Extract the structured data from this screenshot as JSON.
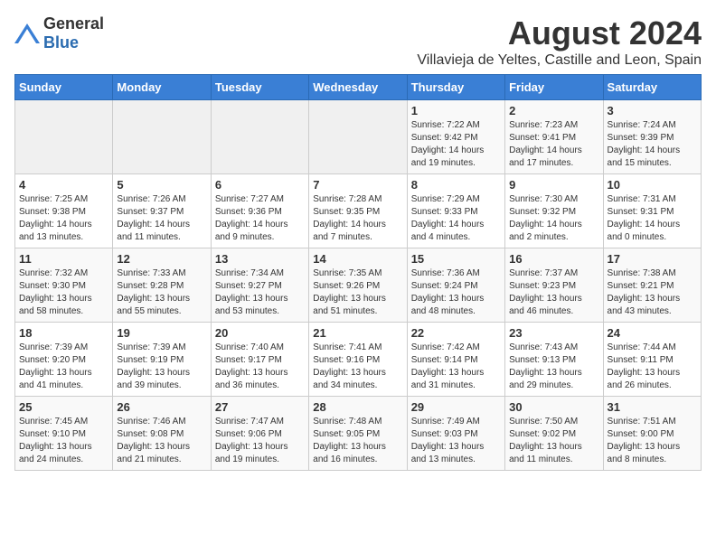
{
  "logo": {
    "text_general": "General",
    "text_blue": "Blue"
  },
  "title": "August 2024",
  "subtitle": "Villavieja de Yeltes, Castille and Leon, Spain",
  "days_of_week": [
    "Sunday",
    "Monday",
    "Tuesday",
    "Wednesday",
    "Thursday",
    "Friday",
    "Saturday"
  ],
  "weeks": [
    [
      {
        "day": "",
        "info": ""
      },
      {
        "day": "",
        "info": ""
      },
      {
        "day": "",
        "info": ""
      },
      {
        "day": "",
        "info": ""
      },
      {
        "day": "1",
        "info": "Sunrise: 7:22 AM\nSunset: 9:42 PM\nDaylight: 14 hours and 19 minutes."
      },
      {
        "day": "2",
        "info": "Sunrise: 7:23 AM\nSunset: 9:41 PM\nDaylight: 14 hours and 17 minutes."
      },
      {
        "day": "3",
        "info": "Sunrise: 7:24 AM\nSunset: 9:39 PM\nDaylight: 14 hours and 15 minutes."
      }
    ],
    [
      {
        "day": "4",
        "info": "Sunrise: 7:25 AM\nSunset: 9:38 PM\nDaylight: 14 hours and 13 minutes."
      },
      {
        "day": "5",
        "info": "Sunrise: 7:26 AM\nSunset: 9:37 PM\nDaylight: 14 hours and 11 minutes."
      },
      {
        "day": "6",
        "info": "Sunrise: 7:27 AM\nSunset: 9:36 PM\nDaylight: 14 hours and 9 minutes."
      },
      {
        "day": "7",
        "info": "Sunrise: 7:28 AM\nSunset: 9:35 PM\nDaylight: 14 hours and 7 minutes."
      },
      {
        "day": "8",
        "info": "Sunrise: 7:29 AM\nSunset: 9:33 PM\nDaylight: 14 hours and 4 minutes."
      },
      {
        "day": "9",
        "info": "Sunrise: 7:30 AM\nSunset: 9:32 PM\nDaylight: 14 hours and 2 minutes."
      },
      {
        "day": "10",
        "info": "Sunrise: 7:31 AM\nSunset: 9:31 PM\nDaylight: 14 hours and 0 minutes."
      }
    ],
    [
      {
        "day": "11",
        "info": "Sunrise: 7:32 AM\nSunset: 9:30 PM\nDaylight: 13 hours and 58 minutes."
      },
      {
        "day": "12",
        "info": "Sunrise: 7:33 AM\nSunset: 9:28 PM\nDaylight: 13 hours and 55 minutes."
      },
      {
        "day": "13",
        "info": "Sunrise: 7:34 AM\nSunset: 9:27 PM\nDaylight: 13 hours and 53 minutes."
      },
      {
        "day": "14",
        "info": "Sunrise: 7:35 AM\nSunset: 9:26 PM\nDaylight: 13 hours and 51 minutes."
      },
      {
        "day": "15",
        "info": "Sunrise: 7:36 AM\nSunset: 9:24 PM\nDaylight: 13 hours and 48 minutes."
      },
      {
        "day": "16",
        "info": "Sunrise: 7:37 AM\nSunset: 9:23 PM\nDaylight: 13 hours and 46 minutes."
      },
      {
        "day": "17",
        "info": "Sunrise: 7:38 AM\nSunset: 9:21 PM\nDaylight: 13 hours and 43 minutes."
      }
    ],
    [
      {
        "day": "18",
        "info": "Sunrise: 7:39 AM\nSunset: 9:20 PM\nDaylight: 13 hours and 41 minutes."
      },
      {
        "day": "19",
        "info": "Sunrise: 7:39 AM\nSunset: 9:19 PM\nDaylight: 13 hours and 39 minutes."
      },
      {
        "day": "20",
        "info": "Sunrise: 7:40 AM\nSunset: 9:17 PM\nDaylight: 13 hours and 36 minutes."
      },
      {
        "day": "21",
        "info": "Sunrise: 7:41 AM\nSunset: 9:16 PM\nDaylight: 13 hours and 34 minutes."
      },
      {
        "day": "22",
        "info": "Sunrise: 7:42 AM\nSunset: 9:14 PM\nDaylight: 13 hours and 31 minutes."
      },
      {
        "day": "23",
        "info": "Sunrise: 7:43 AM\nSunset: 9:13 PM\nDaylight: 13 hours and 29 minutes."
      },
      {
        "day": "24",
        "info": "Sunrise: 7:44 AM\nSunset: 9:11 PM\nDaylight: 13 hours and 26 minutes."
      }
    ],
    [
      {
        "day": "25",
        "info": "Sunrise: 7:45 AM\nSunset: 9:10 PM\nDaylight: 13 hours and 24 minutes."
      },
      {
        "day": "26",
        "info": "Sunrise: 7:46 AM\nSunset: 9:08 PM\nDaylight: 13 hours and 21 minutes."
      },
      {
        "day": "27",
        "info": "Sunrise: 7:47 AM\nSunset: 9:06 PM\nDaylight: 13 hours and 19 minutes."
      },
      {
        "day": "28",
        "info": "Sunrise: 7:48 AM\nSunset: 9:05 PM\nDaylight: 13 hours and 16 minutes."
      },
      {
        "day": "29",
        "info": "Sunrise: 7:49 AM\nSunset: 9:03 PM\nDaylight: 13 hours and 13 minutes."
      },
      {
        "day": "30",
        "info": "Sunrise: 7:50 AM\nSunset: 9:02 PM\nDaylight: 13 hours and 11 minutes."
      },
      {
        "day": "31",
        "info": "Sunrise: 7:51 AM\nSunset: 9:00 PM\nDaylight: 13 hours and 8 minutes."
      }
    ]
  ]
}
